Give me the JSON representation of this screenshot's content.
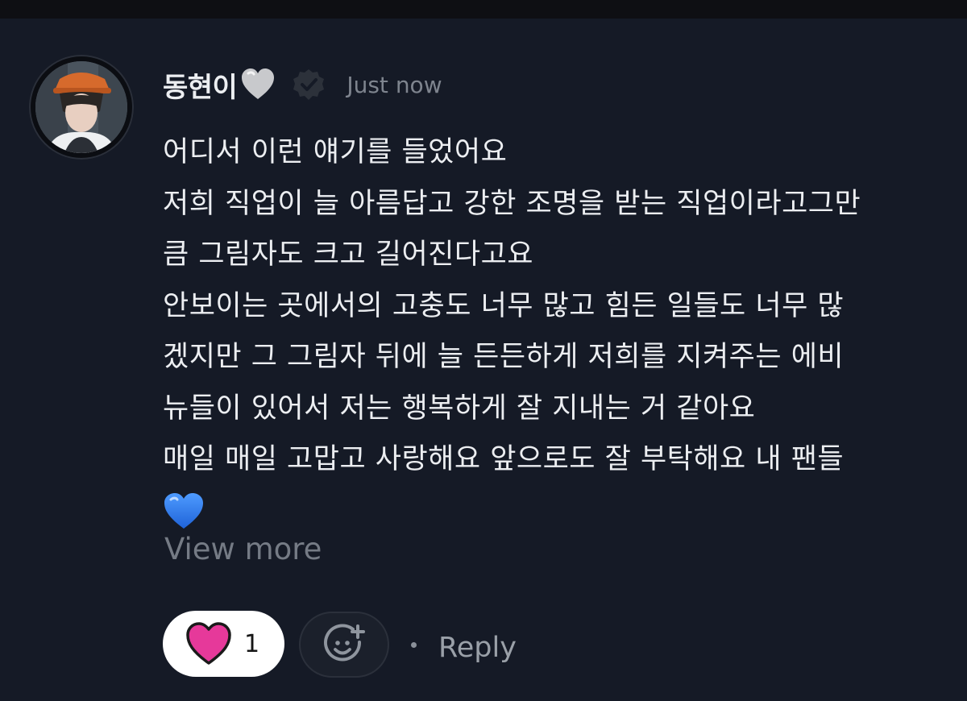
{
  "comment": {
    "username": "동현이",
    "timestamp": "Just now",
    "lines": [
      "어디서 이런 얘기를 들었어요",
      "저희 직업이 늘 아름답고 강한 조명을 받는 직업이라고그만",
      "큼 그림자도 크고 길어진다고요",
      "안보이는 곳에서의 고충도 너무 많고 힘든 일들도 너무 많",
      "겠지만 그 그림자 뒤에 늘 든든하게 저희를 지켜주는 에비",
      "뉴들이 있어서 저는 행복하게 잘 지내는 거 같아요",
      "매일 매일 고맙고 사랑해요 앞으로도 잘 부탁해요 내 팬들"
    ],
    "view_more": "View more"
  },
  "actions": {
    "like_count": "1",
    "reply_label": "Reply"
  },
  "icons": {
    "name_emoji": "grey-heart-icon",
    "verified": "verified-badge-icon",
    "body_emoji": "blue-heart-icon",
    "like": "pink-heart-icon",
    "add_reaction": "add-reaction-icon"
  },
  "colors": {
    "background": "#151a26",
    "text": "#eceef1",
    "muted": "#757b85",
    "like_heart": "#e6399a",
    "blue_heart": "#2f7df0"
  }
}
